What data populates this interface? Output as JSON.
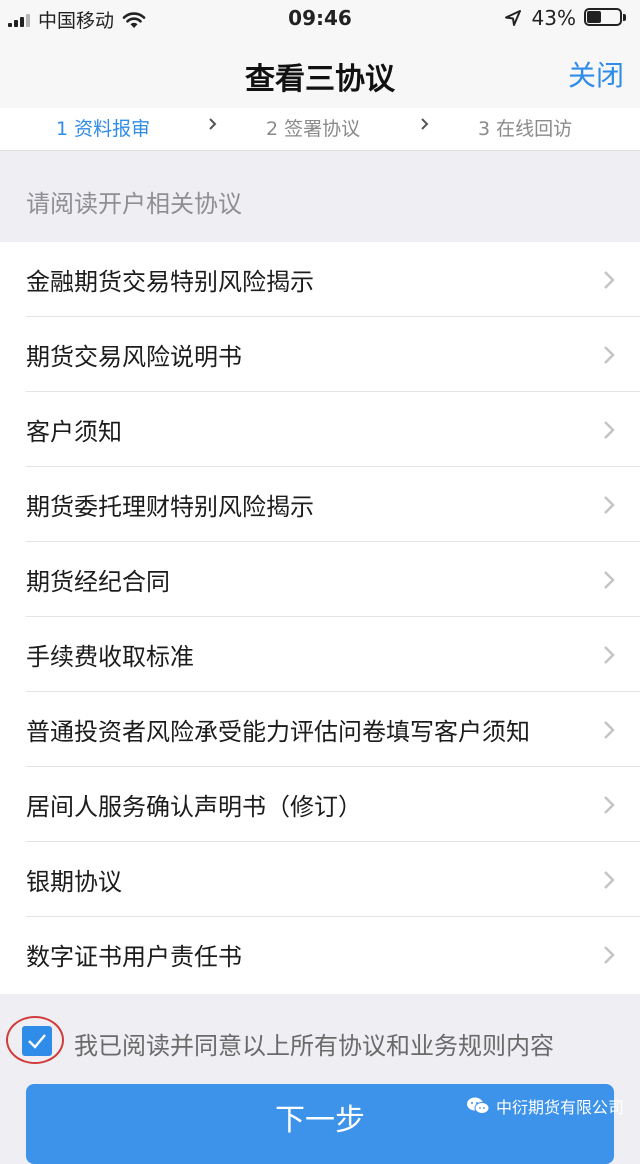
{
  "status_bar": {
    "carrier": "中国移动",
    "time": "09:46",
    "battery_percent": "43%",
    "battery_level": 0.43,
    "icons": [
      "signal-icon",
      "wifi-icon",
      "location-icon",
      "battery-icon"
    ]
  },
  "nav": {
    "title": "查看三协议",
    "close_label": "关闭"
  },
  "steps": [
    {
      "label": "1 资料报审",
      "state": "active"
    },
    {
      "label": "2 签署协议",
      "state": "inactive"
    },
    {
      "label": "3 在线回访",
      "state": "inactive"
    }
  ],
  "section_label": "请阅读开户相关协议",
  "agreements": [
    "金融期货交易特别风险揭示",
    "期货交易风险说明书",
    "客户须知",
    "期货委托理财特别风险揭示",
    "期货经纪合同",
    "手续费收取标准",
    "普通投资者风险承受能力评估问卷填写客户须知",
    "居间人服务确认声明书（修订）",
    "银期协议",
    "数字证书用户责任书"
  ],
  "agree": {
    "checked": true,
    "text": "我已阅读并同意以上所有协议和业务规则内容"
  },
  "next_button_label": "下一步",
  "watermark": "中衍期货有限公司",
  "colors": {
    "accent": "#2f8ce8",
    "button": "#3d92ea",
    "annotation_circle": "#d23b3b"
  }
}
